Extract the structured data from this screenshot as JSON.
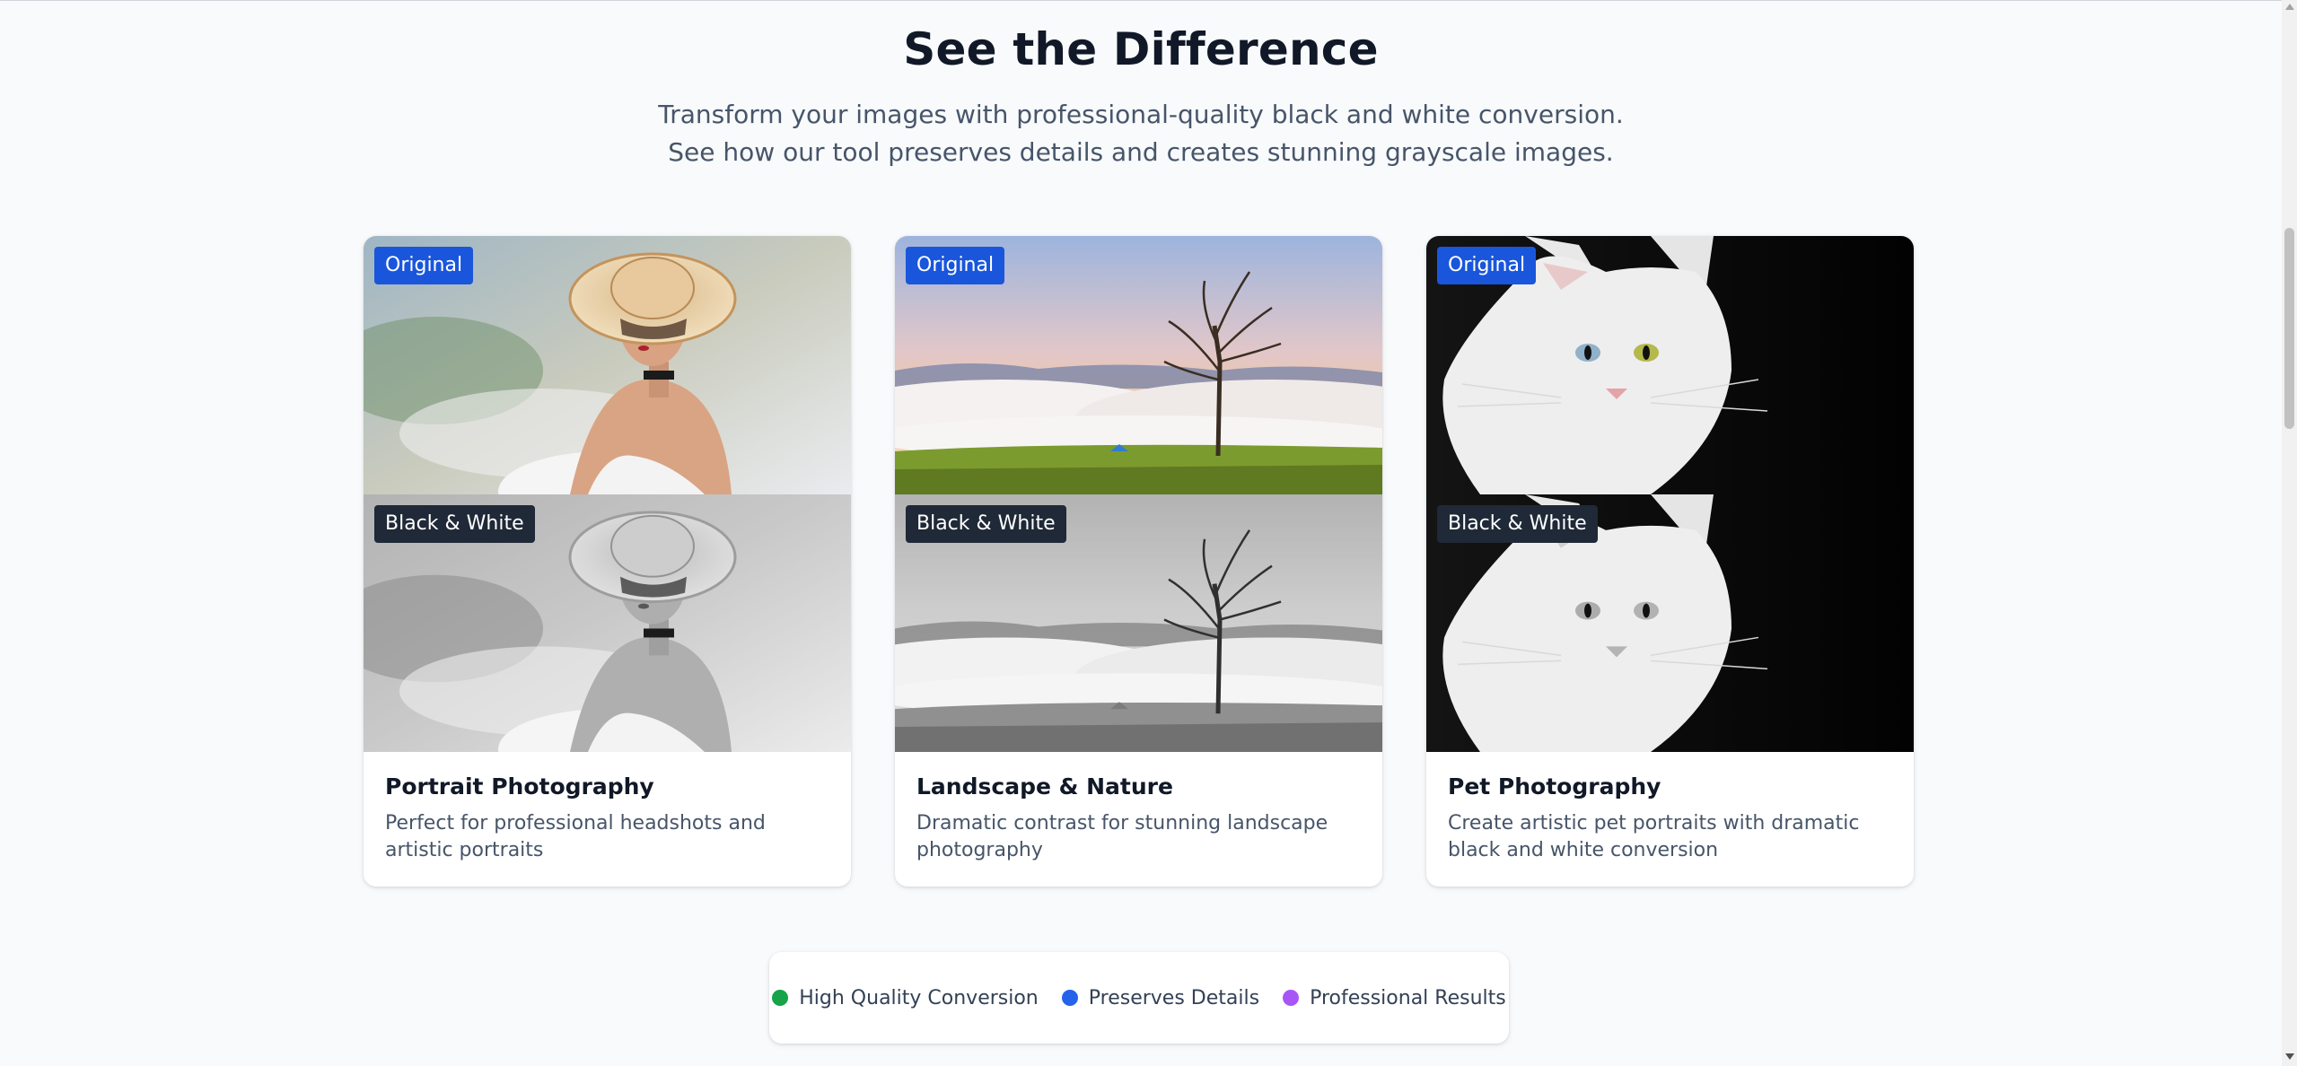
{
  "header": {
    "title": "See the Difference",
    "subtitle_line1": "Transform your images with professional-quality black and white conversion.",
    "subtitle_line2": "See how our tool preserves details and creates stunning grayscale images."
  },
  "badges": {
    "original": "Original",
    "bw": "Black & White"
  },
  "cards": [
    {
      "title": "Portrait Photography",
      "description": "Perfect for professional headshots and artistic portraits",
      "image": "portrait-woman-hat"
    },
    {
      "title": "Landscape & Nature",
      "description": "Dramatic contrast for stunning landscape photography",
      "image": "landscape-tree-fog"
    },
    {
      "title": "Pet Photography",
      "description": "Create artistic pet portraits with dramatic black and white conversion",
      "image": "white-cat"
    }
  ],
  "features": [
    {
      "label": "High Quality Conversion",
      "color": "#16a34a"
    },
    {
      "label": "Preserves Details",
      "color": "#2563eb"
    },
    {
      "label": "Professional Results",
      "color": "#a855f7"
    }
  ]
}
